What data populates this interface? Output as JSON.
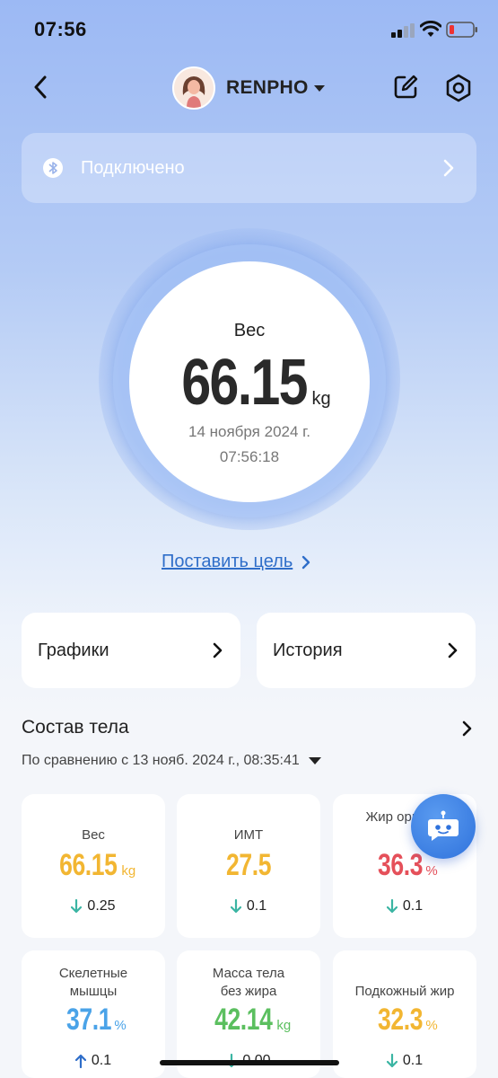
{
  "status_bar": {
    "time": "07:56"
  },
  "header": {
    "profile_name": "RENPHO"
  },
  "connection": {
    "label": "Подключено"
  },
  "weight_gauge": {
    "label": "Вес",
    "value": "66.15",
    "unit": "kg",
    "date": "14 ноября 2024 г.",
    "time": "07:56:18"
  },
  "goal_link": {
    "label": "Поставить цель"
  },
  "nav_cards": [
    {
      "label": "Графики"
    },
    {
      "label": "История"
    }
  ],
  "body_composition": {
    "title": "Состав тела",
    "compare_text": "По сравнению с 13 нояб. 2024 г., 08:35:41",
    "metrics": [
      {
        "name": "Вес",
        "value": "66.15",
        "unit": "kg",
        "change": "0.25",
        "direction": "down",
        "color": "#f2b632"
      },
      {
        "name": "ИМТ",
        "value": "27.5",
        "unit": "",
        "change": "0.1",
        "direction": "down",
        "color": "#f2b632"
      },
      {
        "name": "Жир организма",
        "name_visible": "Жир органи",
        "value": "36.3",
        "unit": "%",
        "change": "0.1",
        "direction": "down",
        "color": "#e5505a"
      },
      {
        "name_line1": "Скелетные",
        "name_line2": "мышцы",
        "value": "37.1",
        "unit": "%",
        "change": "0.1",
        "direction": "up",
        "color": "#4aa3e8"
      },
      {
        "name_line1": "Масса тела",
        "name_line2": "без жира",
        "value": "42.14",
        "unit": "kg",
        "change": "0.00",
        "direction": "down",
        "color": "#5bbf5f"
      },
      {
        "name": "Подкожный жир",
        "value": "32.3",
        "unit": "%",
        "change": "0.1",
        "direction": "down",
        "color": "#f2b632"
      }
    ]
  },
  "colors": {
    "accent_link": "#2f6ec9",
    "arrow_down": "#3bb5a3",
    "arrow_up": "#2f6ec9"
  }
}
